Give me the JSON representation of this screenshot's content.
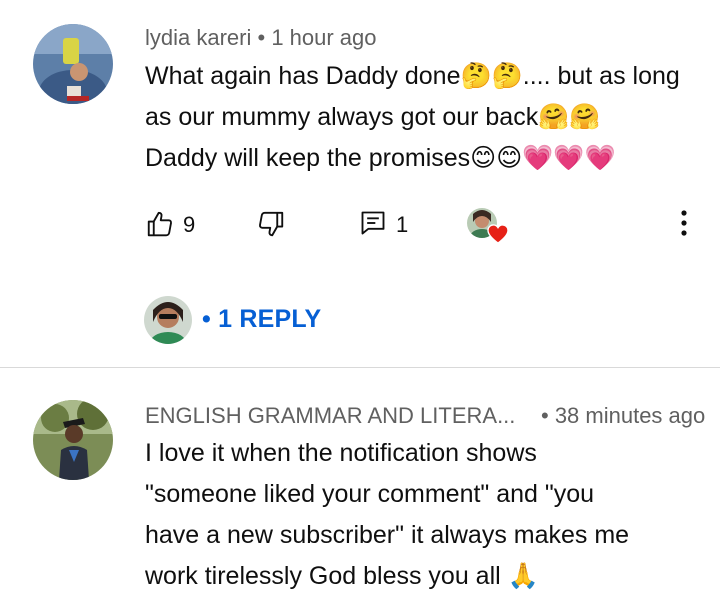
{
  "comments": [
    {
      "author": "lydia kareri",
      "time": "• 1 hour ago",
      "lines": [
        "What again has Daddy done🤔🤔.... but as long",
        "as our mummy always got our back🤗🤗",
        "Daddy will keep the promises😊😊💗💗💗"
      ],
      "likes": "9",
      "replies_count": "1",
      "reply_link": "• 1 REPLY"
    },
    {
      "author": "ENGLISH GRAMMAR AND LITERA...",
      "time": "• 38 minutes ago",
      "lines": [
        "I love it when the notification shows",
        "\"someone liked your comment\" and \"you",
        "have a new subscriber\" it always makes me",
        "work tirelessly God bless you all 🙏"
      ]
    }
  ],
  "icons": {
    "like": "thumbs-up-icon",
    "dislike": "thumbs-down-icon",
    "reply": "reply-icon",
    "heart": "creator-heart-icon",
    "more": "more-vertical-icon"
  },
  "colors": {
    "link": "#065fd4",
    "meta": "#606060",
    "heart": "#e62117",
    "divider": "#d9d9d9"
  }
}
